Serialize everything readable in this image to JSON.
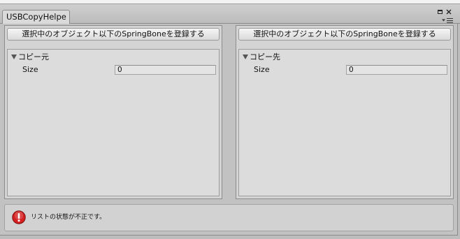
{
  "window": {
    "tab_title": "USBCopyHelpe",
    "title_bar_icons": {
      "maximize": "maximize-icon",
      "close": "close-icon",
      "menu": "context-menu-icon"
    }
  },
  "panels": [
    {
      "button_label": "選択中のオブジェクト以下のSpringBoneを登録する",
      "foldout": {
        "label": "コピー元",
        "expanded": true,
        "icon": "foldout-arrow-icon"
      },
      "size": {
        "label": "Size",
        "value": "0"
      }
    },
    {
      "button_label": "選択中のオブジェクト以下のSpringBoneを登録する",
      "foldout": {
        "label": "コピー先",
        "expanded": true,
        "icon": "foldout-arrow-icon"
      },
      "size": {
        "label": "Size",
        "value": "0"
      }
    }
  ],
  "help_box": {
    "icon": "error-icon",
    "message": "リストの状態が不正です。"
  },
  "colors": {
    "error_icon": "#d42020",
    "window_background": "#c2c2c2",
    "panel_background": "#d4d4d4"
  }
}
